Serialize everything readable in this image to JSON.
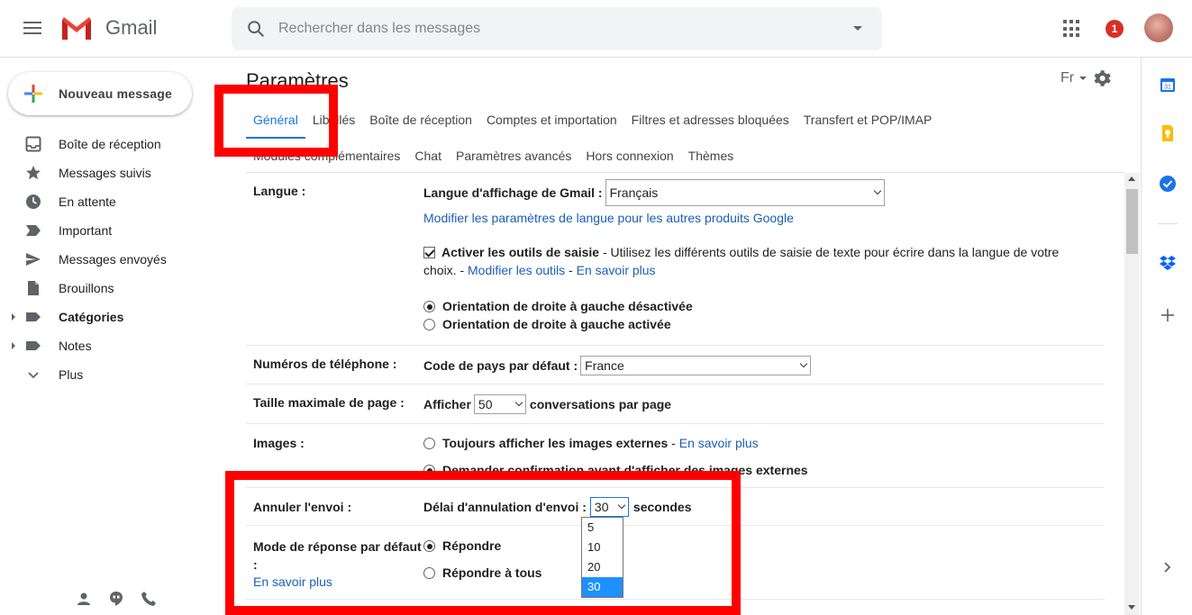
{
  "header": {
    "app_name": "Gmail",
    "search_placeholder": "Rechercher dans les messages",
    "notification_count": "1"
  },
  "sidebar": {
    "compose_label": "Nouveau message",
    "items": [
      {
        "label": "Boîte de réception",
        "icon": "inbox-icon"
      },
      {
        "label": "Messages suivis",
        "icon": "star-icon"
      },
      {
        "label": "En attente",
        "icon": "clock-icon"
      },
      {
        "label": "Important",
        "icon": "important-icon"
      },
      {
        "label": "Messages envoyés",
        "icon": "send-icon"
      },
      {
        "label": "Brouillons",
        "icon": "draft-icon"
      },
      {
        "label": "Catégories",
        "icon": "label-icon"
      },
      {
        "label": "Notes",
        "icon": "label-icon"
      },
      {
        "label": "Plus",
        "icon": "chevron-down-icon"
      }
    ]
  },
  "settings": {
    "title": "Paramètres",
    "lang_indicator": "Fr",
    "tabs_row1": [
      "Général",
      "Libellés",
      "Boîte de réception",
      "Comptes et importation",
      "Filtres et adresses bloquées",
      "Transfert et POP/IMAP"
    ],
    "tabs_row2": [
      "Modules complémentaires",
      "Chat",
      "Paramètres avancés",
      "Hors connexion",
      "Thèmes"
    ],
    "language": {
      "label": "Langue :",
      "display_label": "Langue d'affichage de Gmail :",
      "display_value": "Français",
      "other_products_link": "Modifier les paramètres de langue pour les autres produits Google",
      "input_tools_bold": "Activer les outils de saisie",
      "input_tools_text": " - Utilisez les différents outils de saisie de texte pour écrire dans la langue de votre",
      "input_tools_text2": "choix. - ",
      "edit_tools_link": "Modifier les outils",
      "sep": " - ",
      "learn_more": "En savoir plus",
      "rtl_off": "Orientation de droite à gauche désactivée",
      "rtl_on": "Orientation de droite à gauche activée"
    },
    "phone": {
      "label": "Numéros de téléphone :",
      "country_label": "Code de pays par défaut :",
      "country_value": "France"
    },
    "page_size": {
      "label": "Taille maximale de page :",
      "prefix": "Afficher",
      "value": "50",
      "suffix": "conversations par page"
    },
    "images": {
      "label": "Images :",
      "always": "Toujours afficher les images externes",
      "sep": " - ",
      "learn_more": "En savoir plus",
      "ask": "Demander confirmation avant d'afficher des images externes"
    },
    "undo_send": {
      "label": "Annuler l'envoi :",
      "delay_label": "Délai d'annulation d'envoi :",
      "value": "30",
      "suffix": "secondes",
      "options": [
        "5",
        "10",
        "20",
        "30"
      ]
    },
    "reply_mode": {
      "label1": "Mode de réponse par défaut",
      "label2": ":",
      "learn_more": "En savoir plus",
      "reply": "Répondre",
      "reply_all": "Répondre à tous"
    }
  },
  "colors": {
    "accent": "#1a73e8",
    "link": "#1a5fb4",
    "highlight_box": "#ff0000",
    "badge": "#d93025"
  }
}
